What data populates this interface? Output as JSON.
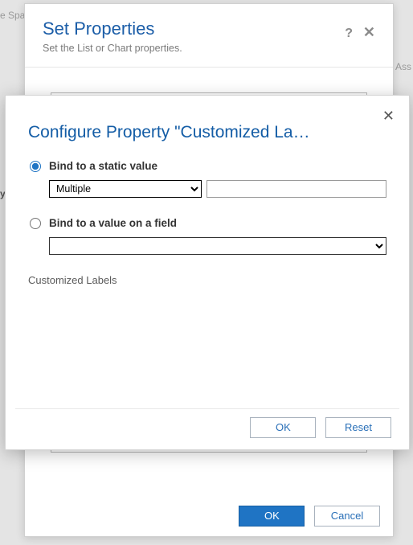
{
  "bg": {
    "spa_hint": "e Spa",
    "asst_hint": "Ass",
    "left1": "y"
  },
  "setprops": {
    "title": "Set Properties",
    "subtitle": "Set the List or Chart properties.",
    "help_icon": "?",
    "close_icon": "✕",
    "ok_label": "OK",
    "cancel_label": "Cancel"
  },
  "config": {
    "title": "Configure Property \"Customized La…",
    "close_icon": "✕",
    "opt_static_label": "Bind to a static value",
    "static_select_value": "Multiple",
    "static_input_value": "",
    "opt_field_label": "Bind to a value on a field",
    "field_select_value": "",
    "customized_labels_text": "Customized Labels",
    "ok_label": "OK",
    "reset_label": "Reset"
  }
}
